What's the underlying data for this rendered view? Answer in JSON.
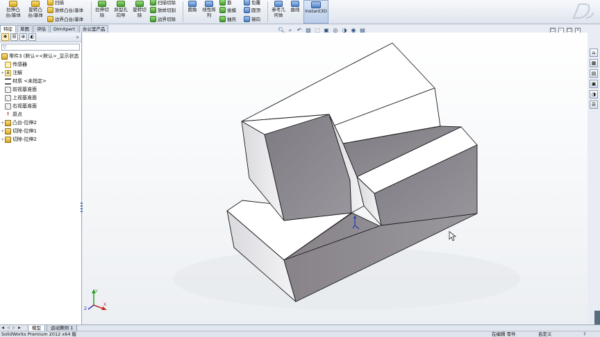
{
  "ribbon": {
    "boss_extrude": "拉伸凸\n台/基体",
    "revolve_boss": "旋转凸\n台/基体",
    "sweep": "扫描",
    "loft": "放样凸台/基体",
    "boundary": "边界凸台/基体",
    "extruded_cut": "拉伸切\n除",
    "hole_wizard": "异型孔\n向导",
    "revolved_cut": "旋转切\n除",
    "swept_cut": "扫描切除",
    "lofted_cut": "放样切割",
    "boundary_cut": "边界切除",
    "fillet": "圆角",
    "linear_pattern": "线性阵\n列",
    "rib": "筋",
    "draft": "拔模",
    "shell": "抽壳",
    "wrap": "包覆",
    "dome": "圆顶",
    "mirror": "镜向",
    "ref_geometry": "参考几\n何体",
    "curves": "曲线",
    "instant3d": "Instant3D"
  },
  "command_tabs": [
    "特征",
    "草图",
    "评估",
    "DimXpert",
    "办公室产品"
  ],
  "feature_tree": {
    "root": "零件3 (默认<<默认>_显示状态",
    "items": [
      {
        "label": "传感器",
        "icon": "sensor-icon",
        "expand": ""
      },
      {
        "label": "注解",
        "icon": "annotation-icon",
        "expand": "+"
      },
      {
        "label": "材质 <未指定>",
        "icon": "material-icon",
        "expand": ""
      },
      {
        "label": "前视基准面",
        "icon": "plane-icon",
        "expand": ""
      },
      {
        "label": "上视基准面",
        "icon": "plane-icon",
        "expand": ""
      },
      {
        "label": "右视基准面",
        "icon": "plane-icon",
        "expand": ""
      },
      {
        "label": "原点",
        "icon": "origin-icon",
        "expand": ""
      },
      {
        "label": "凸台-拉伸2",
        "icon": "extrude-feature-icon",
        "expand": "+"
      },
      {
        "label": "切除-拉伸1",
        "icon": "cut-feature-icon",
        "expand": "+"
      },
      {
        "label": "切除-拉伸2",
        "icon": "cut-feature-icon",
        "expand": "+"
      }
    ]
  },
  "bottom_tabs": [
    "模型",
    "运动算例 1"
  ],
  "status": {
    "app": "SolidWorks Premium 2012 x64 版",
    "mode": "在编辑 零件",
    "units": "自定义",
    "help": "?"
  },
  "colors": {
    "face_top": "#ffffff",
    "face_front": "#8f8a92",
    "face_side": "#e4e4e8",
    "edge": "#1a1a1a",
    "accent": "#2f5c9a"
  }
}
